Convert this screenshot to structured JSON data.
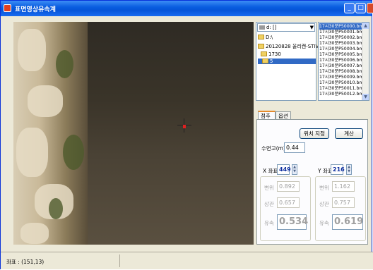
{
  "window": {
    "title": "표면영상유속계"
  },
  "titlebar": {
    "min": "_",
    "max": "□",
    "close": "×"
  },
  "tree": {
    "drive": "d: []",
    "nodes": [
      {
        "label": "D:\\",
        "selected": false
      },
      {
        "label": "20120828 울리캔-STIV",
        "selected": false
      },
      {
        "label": "1730",
        "selected": false
      },
      {
        "label": "5",
        "selected": true
      }
    ]
  },
  "files": [
    "17시30분P50000.bmp",
    "17시30분P50001.bmp",
    "17시30분P50002.bmp",
    "17시30분P50003.bmp",
    "17시30분P50004.bmp",
    "17시30분P50005.bmp",
    "17시30분P50006.bmp",
    "17시30분P50007.bmp",
    "17시30분P50008.bmp",
    "17시30분P50009.bmp",
    "17시30분P50010.bmp",
    "17시30분P50011.bmp",
    "17시30분P50012.bmp"
  ],
  "tabs": {
    "tab1": "점추출",
    "tab2": "옵션"
  },
  "panel": {
    "position_button": "위치 지정",
    "calc_button": "계산",
    "water_depth_label": "수면고(m)",
    "water_depth_value": "0.44",
    "x_label": "X 좌표",
    "x_value": "449",
    "y_label": "Y 좌표",
    "y_value": "216",
    "x_group": {
      "disp_label": "변위",
      "disp_value": "0.892",
      "corr_label": "상관",
      "corr_value": "0.657",
      "vel_label": "유속",
      "vel_value": "0.534"
    },
    "y_group": {
      "disp_label": "변위",
      "disp_value": "1.162",
      "corr_label": "상관",
      "corr_value": "0.757",
      "vel_label": "유속",
      "vel_value": "0.619"
    }
  },
  "status": {
    "coords": "좌표 : (151,13)"
  },
  "icons": {
    "app": "app-icon",
    "drive": "drive-icon",
    "folder": "folder-icon"
  }
}
